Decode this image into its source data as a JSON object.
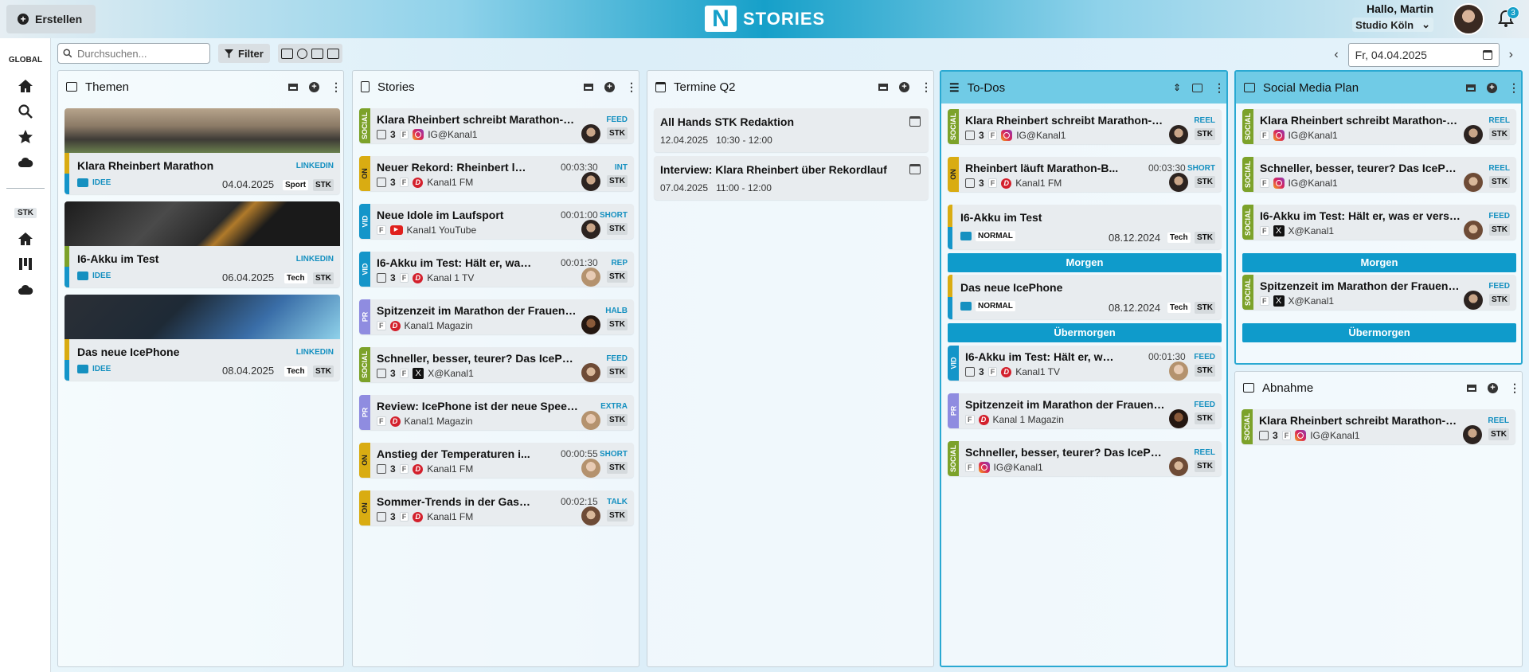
{
  "header": {
    "create_label": "Erstellen",
    "logo_letter": "N",
    "brand": "STORIES",
    "greeting": "Hallo, Martin",
    "studio": "Studio Köln",
    "notifications": "3"
  },
  "sidebar": {
    "global_label": "GLOBAL",
    "stk_label": "STK"
  },
  "toolbar": {
    "search_placeholder": "Durchsuchen...",
    "filter_label": "Filter",
    "date": "Fr, 04.04.2025"
  },
  "columns": {
    "themen": {
      "title": "Themen"
    },
    "stories": {
      "title": "Stories"
    },
    "termine": {
      "title": "Termine Q2"
    },
    "todos": {
      "title": "To-Dos"
    },
    "social": {
      "title": "Social Media Plan"
    },
    "abnahme": {
      "title": "Abnahme"
    }
  },
  "themen": [
    {
      "title": "Klara Rheinbert Marathon",
      "tag": "LINKEDIN",
      "status": "IDEE",
      "date": "04.04.2025",
      "category": "Sport",
      "team": "STK"
    },
    {
      "title": "I6-Akku im Test",
      "tag": "LINKEDIN",
      "status": "IDEE",
      "date": "06.04.2025",
      "category": "Tech",
      "team": "STK"
    },
    {
      "title": "Das neue IcePhone",
      "tag": "LINKEDIN",
      "status": "IDEE",
      "date": "08.04.2025",
      "category": "Tech",
      "team": "STK"
    }
  ],
  "stories": [
    {
      "stripe": "SOCIAL",
      "title": "Klara Rheinbert schreibt Marathon-Ge...",
      "duration": "",
      "tag": "FEED",
      "count": "3",
      "f": "F",
      "channel": "IG@Kanal1",
      "team": "STK"
    },
    {
      "stripe": "ON",
      "title": "Neuer Rekord: Rheinbert läuft...",
      "duration": "00:03:30",
      "tag": "INT",
      "count": "3",
      "f": "F",
      "channel": "Kanal1 FM",
      "team": "STK"
    },
    {
      "stripe": "VID",
      "title": "Neue Idole im Laufsport",
      "duration": "00:01:00",
      "tag": "SHORT",
      "count": "",
      "f": "F",
      "channel": "Kanal1 YouTube",
      "team": "STK"
    },
    {
      "stripe": "VID",
      "title": "I6-Akku im Test: Hält er, was er...",
      "duration": "00:01:30",
      "tag": "REP",
      "count": "3",
      "f": "F",
      "channel": "Kanal 1 TV",
      "team": "STK"
    },
    {
      "stripe": "PR",
      "title": "Spitzenzeit im Marathon der Frauen: K...",
      "duration": "",
      "tag": "HALB",
      "count": "",
      "f": "F",
      "channel": "Kanal1 Magazin",
      "team": "STK"
    },
    {
      "stripe": "SOCIAL",
      "title": "Schneller, besser, teurer? Das IcePhon...",
      "duration": "",
      "tag": "FEED",
      "count": "3",
      "f": "F",
      "channel": "X@Kanal1",
      "team": "STK"
    },
    {
      "stripe": "PR",
      "title": "Review: IcePhone ist der neue Speed...",
      "duration": "",
      "tag": "EXTRA",
      "count": "",
      "f": "F",
      "channel": "Kanal1 Magazin",
      "team": "STK"
    },
    {
      "stripe": "ON",
      "title": "Anstieg der Temperaturen i...",
      "duration": "00:00:55",
      "tag": "SHORT",
      "count": "3",
      "f": "F",
      "channel": "Kanal1 FM",
      "team": "STK"
    },
    {
      "stripe": "ON",
      "title": "Sommer-Trends in der Gastro...",
      "duration": "00:02:15",
      "tag": "TALK",
      "count": "3",
      "f": "F",
      "channel": "Kanal1 FM",
      "team": "STK"
    }
  ],
  "termine": [
    {
      "title": "All Hands STK Redaktion",
      "date": "12.04.2025",
      "time": "10:30 - 12:00"
    },
    {
      "title": "Interview: Klara Rheinbert über Rekordlauf",
      "date": "07.04.2025",
      "time": "11:00 - 12:00"
    }
  ],
  "todos": {
    "top": [
      {
        "stripe": "SOCIAL",
        "title": "Klara Rheinbert schreibt Marathon-Ge...",
        "duration": "",
        "tag": "REEL",
        "count": "3",
        "f": "F",
        "channel": "IG@Kanal1",
        "team": "STK"
      },
      {
        "stripe": "ON",
        "title": "Rheinbert läuft Marathon-B...",
        "duration": "00:03:30",
        "tag": "SHORT",
        "count": "3",
        "f": "F",
        "channel": "Kanal1 FM",
        "team": "STK"
      }
    ],
    "theme1": {
      "title": "I6-Akku im Test",
      "status": "NORMAL",
      "date": "08.12.2024",
      "category": "Tech",
      "team": "STK"
    },
    "divider1": "Morgen",
    "theme2": {
      "title": "Das neue IcePhone",
      "status": "NORMAL",
      "date": "08.12.2024",
      "category": "Tech",
      "team": "STK"
    },
    "divider2": "Übermorgen",
    "bottom": [
      {
        "stripe": "VID",
        "title": "I6-Akku im Test: Hält er, was...",
        "duration": "00:01:30",
        "tag": "FEED",
        "count": "3",
        "f": "F",
        "channel": "Kanal1 TV",
        "team": "STK"
      },
      {
        "stripe": "PR",
        "title": "Spitzenzeit im Marathon der Frauen: K...",
        "duration": "",
        "tag": "FEED",
        "count": "",
        "f": "F",
        "channel": "Kanal 1 Magazin",
        "team": "STK"
      },
      {
        "stripe": "SOCIAL",
        "title": "Schneller, besser, teurer? Das IcePhon...",
        "duration": "",
        "tag": "REEL",
        "count": "",
        "f": "F",
        "channel": "IG@Kanal1",
        "team": "STK"
      }
    ]
  },
  "social": {
    "items": [
      {
        "stripe": "SOCIAL",
        "title": "Klara Rheinbert schreibt Marathon-Ge...",
        "tag": "REEL",
        "f": "F",
        "channel": "IG@Kanal1",
        "team": "STK"
      },
      {
        "stripe": "SOCIAL",
        "title": "Schneller, besser, teurer? Das IcePhon...",
        "tag": "REEL",
        "f": "F",
        "channel": "IG@Kanal1",
        "team": "STK"
      },
      {
        "stripe": "SOCIAL",
        "title": "I6-Akku im Test: Hält er, was er verspri...",
        "tag": "FEED",
        "f": "F",
        "channel": "X@Kanal1",
        "team": "STK"
      },
      {
        "stripe": "SOCIAL",
        "title": "Spitzenzeit im Marathon der Frauen: K...",
        "tag": "FEED",
        "f": "F",
        "channel": "X@Kanal1",
        "team": "STK"
      }
    ],
    "divider1": "Morgen",
    "divider2": "Übermorgen"
  },
  "abnahme": [
    {
      "stripe": "SOCIAL",
      "title": "Klara Rheinbert schreibt Marathon-Ge...",
      "tag": "REEL",
      "count": "3",
      "f": "F",
      "channel": "IG@Kanal1",
      "team": "STK"
    }
  ]
}
